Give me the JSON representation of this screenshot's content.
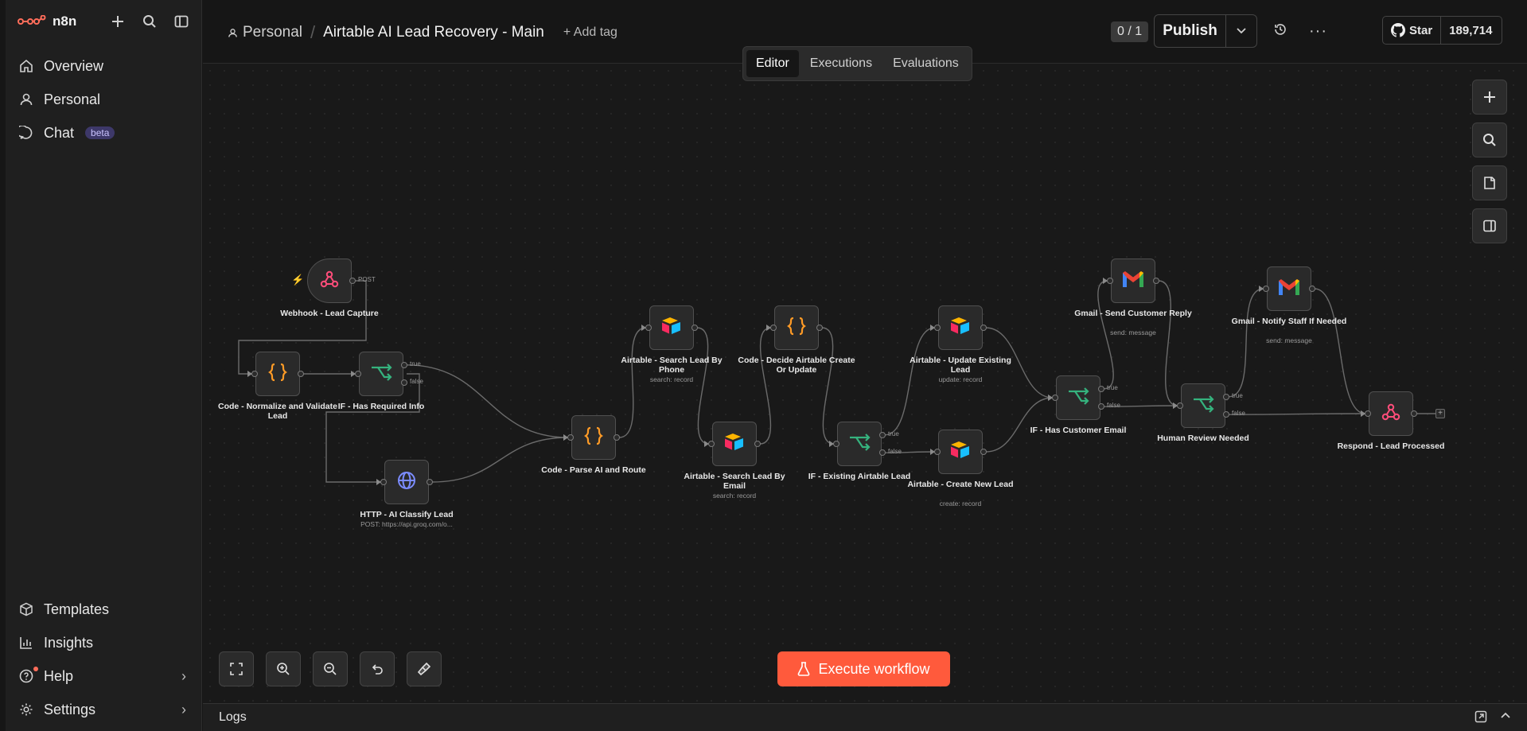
{
  "app": {
    "name": "n8n"
  },
  "sidebar": {
    "top_nav": [
      {
        "label": "Overview",
        "icon": "home-icon"
      },
      {
        "label": "Personal",
        "icon": "user-icon"
      },
      {
        "label": "Chat",
        "icon": "chat-icon",
        "badge": "beta"
      }
    ],
    "bottom_nav": [
      {
        "label": "Templates",
        "icon": "box-icon"
      },
      {
        "label": "Insights",
        "icon": "chart-icon"
      },
      {
        "label": "Help",
        "icon": "help-icon"
      },
      {
        "label": "Settings",
        "icon": "gear-icon"
      }
    ]
  },
  "header": {
    "project": "Personal",
    "workflow_title": "Airtable AI Lead Recovery - Main",
    "add_tag": "+ Add tag",
    "counter": "0 / 1",
    "publish_label": "Publish",
    "github_star": "Star",
    "github_count": "189,714"
  },
  "tabs": [
    "Editor",
    "Executions",
    "Evaluations"
  ],
  "nodes": [
    {
      "id": "webhook",
      "label": "Webhook - Lead Capture",
      "sub": "",
      "type": "webhook",
      "port": "POST"
    },
    {
      "id": "normalize",
      "label": "Code - Normalize and Validate Lead",
      "sub": "",
      "type": "code"
    },
    {
      "id": "ifreq",
      "label": "IF - Has Required Info",
      "sub": "",
      "type": "if"
    },
    {
      "id": "http",
      "label": "HTTP - AI Classify Lead",
      "sub": "POST: https://api.groq.com/o...",
      "type": "http"
    },
    {
      "id": "parse",
      "label": "Code - Parse AI and Route",
      "sub": "",
      "type": "code"
    },
    {
      "id": "searchphone",
      "label": "Airtable - Search Lead By Phone",
      "sub": "search: record",
      "type": "airtable"
    },
    {
      "id": "searchemail",
      "label": "Airtable - Search Lead By Email",
      "sub": "search: record",
      "type": "airtable"
    },
    {
      "id": "decide",
      "label": "Code - Decide Airtable Create Or Update",
      "sub": "",
      "type": "code"
    },
    {
      "id": "ifexist",
      "label": "IF - Existing Airtable Lead",
      "sub": "",
      "type": "if"
    },
    {
      "id": "update",
      "label": "Airtable - Update Existing Lead",
      "sub": "update: record",
      "type": "airtable"
    },
    {
      "id": "create",
      "label": "Airtable - Create New Lead",
      "sub": "create: record",
      "type": "airtable"
    },
    {
      "id": "ifemail",
      "label": "IF - Has Customer Email",
      "sub": "",
      "type": "if"
    },
    {
      "id": "gmailreply",
      "label": "Gmail - Send Customer Reply",
      "sub": "send: message",
      "type": "gmail"
    },
    {
      "id": "review",
      "label": "Human Review Needed",
      "sub": "",
      "type": "if"
    },
    {
      "id": "gmailstaff",
      "label": "Gmail - Notify Staff If Needed",
      "sub": "send: message",
      "type": "gmail"
    },
    {
      "id": "respond",
      "label": "Respond - Lead Processed",
      "sub": "",
      "type": "webhook"
    }
  ],
  "port_labels": {
    "true": "true",
    "false": "false"
  },
  "execute_label": "Execute workflow",
  "logs_label": "Logs",
  "colors": {
    "accent": "#ff5a3c",
    "code": "#ff9b26",
    "if": "#35b37e",
    "http": "#7b8cff",
    "webhook": "#ff4d7a"
  }
}
